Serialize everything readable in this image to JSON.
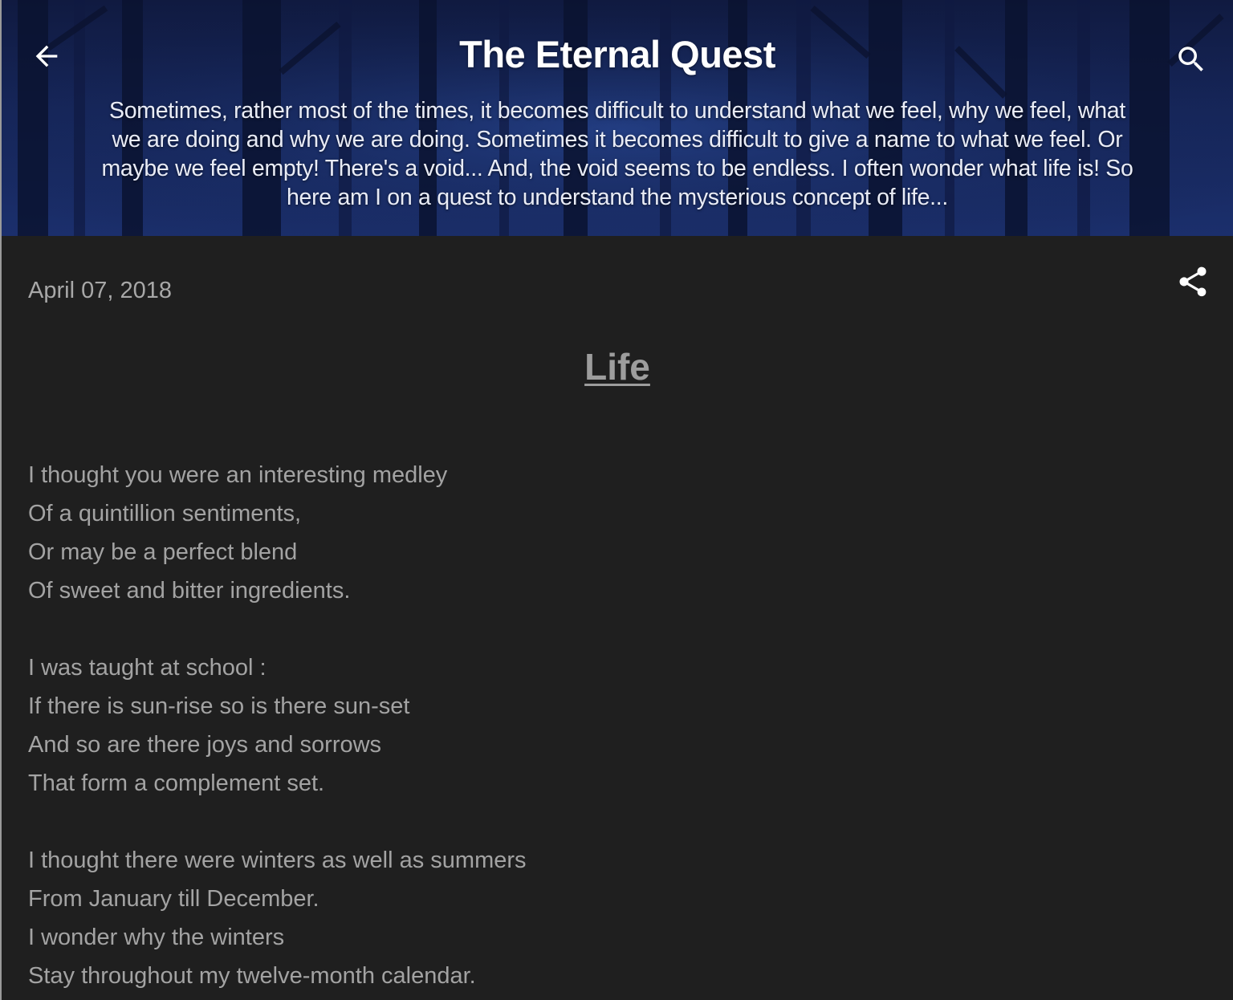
{
  "header": {
    "title": "The Eternal Quest",
    "description": "Sometimes, rather most of the times, it becomes difficult to understand what we feel, why we feel, what we are doing and why we are doing. Sometimes it becomes difficult to give a name to what we feel. Or maybe we feel empty! There's a void... And, the void seems to be endless. I often wonder what life is! So here am I on a quest to understand the mysterious concept of life...",
    "back_icon": "arrow-left-icon",
    "search_icon": "search-icon"
  },
  "post": {
    "date": "April 07, 2018",
    "share_icon": "share-icon",
    "title": "Life",
    "stanzas": [
      [
        "I thought you were an interesting medley",
        "Of a quintillion sentiments,",
        "Or may be a perfect blend",
        "Of sweet and bitter ingredients."
      ],
      [
        "I was taught at school :",
        "If there is sun-rise so is there sun-set",
        "And so are there joys and sorrows",
        "That form a complement set."
      ],
      [
        "I thought there were winters as well as summers",
        "From January till December.",
        "I wonder why the winters",
        "Stay throughout my twelve-month calendar."
      ]
    ]
  },
  "colors": {
    "background": "#1f1f1f",
    "header_blue": "#1b2f6c",
    "text": "#a3a3a3",
    "title_white": "#ffffff"
  }
}
